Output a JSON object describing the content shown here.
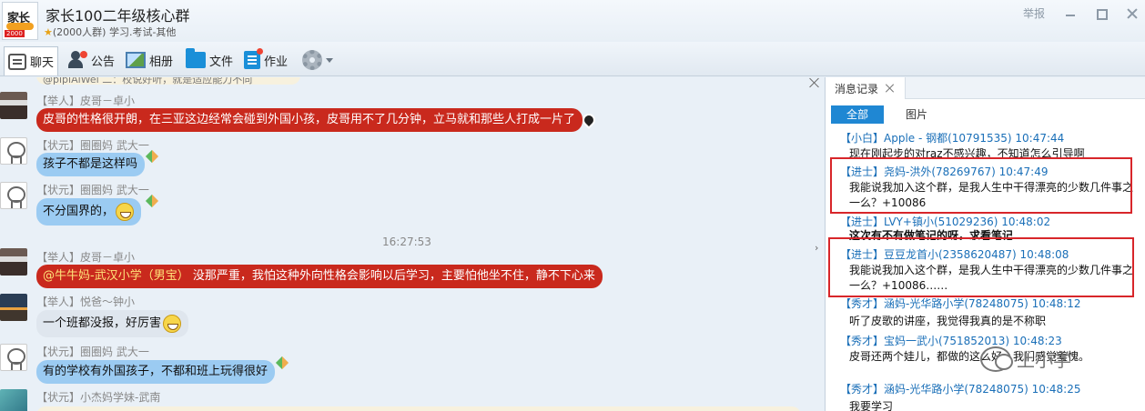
{
  "window": {
    "group_title": "家长100二年级核心群",
    "group_sub": "(2000人群) 学习.考试-其他",
    "logo_text": "家长",
    "logo_badge": "2000",
    "report_label": "举报"
  },
  "toolbar": {
    "chat_label": "聊天",
    "notice_label": "公告",
    "album_label": "相册",
    "file_label": "文件",
    "homework_label": "作业"
  },
  "chat": {
    "top_partial": "@pipiAiWei 二：校说好听，就是适应能力不同",
    "timestamp": "16:27:53",
    "messages": [
      {
        "sender": "【举人】皮哥－卓小",
        "text": "皮哥的性格很开朗，在三亚这边经常会碰到外国小孩，皮哥用不了几分钟，立马就和那些人打成一片了"
      },
      {
        "sender": "【状元】圈圈妈  武大一",
        "text": "孩子不都是这样吗"
      },
      {
        "sender": "【状元】圈圈妈  武大一",
        "text": "不分国界的，"
      },
      {
        "sender": "【举人】皮哥－卓小",
        "mention": "@牛牛妈-武汉小学（男宝）",
        "text": "没那严重，我怕这种外向性格会影响以后学习，主要怕他坐不住，静不下心来"
      },
      {
        "sender": "【举人】悦爸～钟小",
        "text": "一个班都没报，好厉害"
      },
      {
        "sender": "【状元】圈圈妈  武大一",
        "text": "有的学校有外国孩子，不都和班上玩得很好"
      },
      {
        "sender": "【状元】小杰妈学妹-武南",
        "text": ""
      }
    ]
  },
  "panel": {
    "tab_label": "消息记录",
    "filter_all": "全部",
    "filter_images": "图片",
    "records": [
      {
        "head": "【小白】Apple - 钢都(10791535) 10:47:44",
        "body": "现在刚起步的对raz不感兴趣，不知道怎么引导啊"
      },
      {
        "head": "【进士】尧妈-洪外(78269767) 10:47:49",
        "body": "我能说我加入这个群，是我人生中干得漂亮的少数几件事之一么？+10086"
      },
      {
        "head": "【进士】LVY+镇小(51029236) 10:48:02",
        "body": "这次有不有做笔记的呀，求看笔记"
      },
      {
        "head": "【进士】豆豆龙首小(2358620487) 10:48:08",
        "body": "我能说我加入这个群，是我人生中干得漂亮的少数几件事之一么？+10086……"
      },
      {
        "head": "【秀才】涵妈-光华路小学(78248075) 10:48:12",
        "body": "听了皮歌的讲座，我觉得我真的是不称职"
      },
      {
        "head": "【秀才】宝妈一武小(751852013) 10:48:23",
        "body": "皮哥还两个娃儿，都做的这么好，我们感觉羞愧。"
      },
      {
        "head": "【秀才】涵妈-光华路小学(78248075) 10:48:25",
        "body": "我要学习"
      }
    ]
  },
  "watermark": {
    "text": "上小学"
  }
}
